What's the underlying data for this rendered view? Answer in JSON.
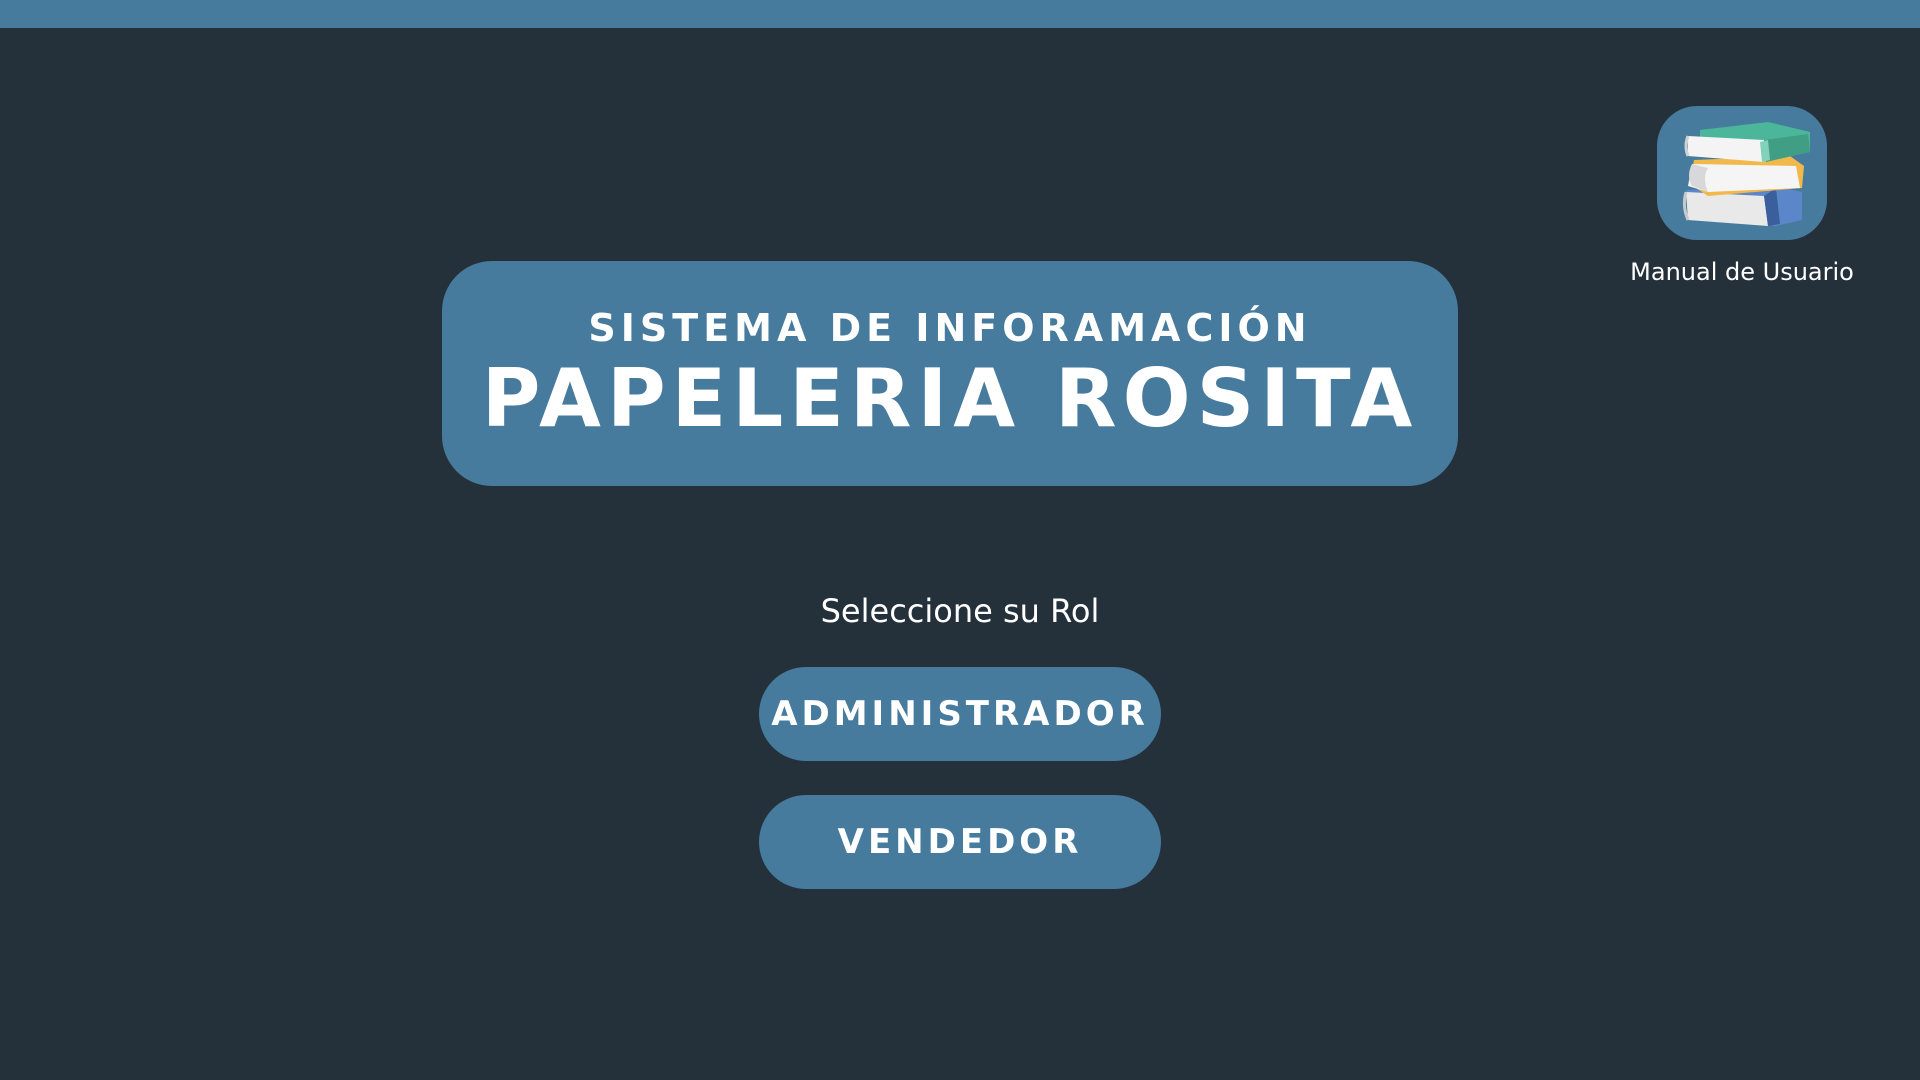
{
  "header": {
    "bar_color": "#477b9e"
  },
  "theme": {
    "background": "#25313a",
    "accent": "#477b9e",
    "text": "#ffffff"
  },
  "manual": {
    "icon": "books-stack-icon",
    "label": "Manual de Usuario"
  },
  "title_card": {
    "subtitle": "SISTEMA DE INFORAMACIÓN",
    "title": "PAPELERIA ROSITA"
  },
  "role_selection": {
    "prompt": "Seleccione su Rol",
    "buttons": [
      {
        "label": "ADMINISTRADOR"
      },
      {
        "label": "VENDEDOR"
      }
    ]
  }
}
